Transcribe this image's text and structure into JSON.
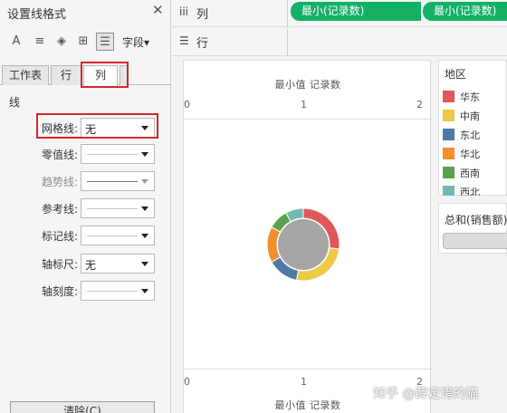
{
  "pane": {
    "title": "设置线格式",
    "close": "✕",
    "toolbar": [
      {
        "name": "font-tool-icon",
        "glyph": "A"
      },
      {
        "name": "align-tool-icon",
        "glyph": "≡"
      },
      {
        "name": "shading-tool-icon",
        "glyph": "◈"
      },
      {
        "name": "borders-tool-icon",
        "glyph": "⊞"
      },
      {
        "name": "lines-tool-icon",
        "glyph": "☰"
      }
    ],
    "field_menu": "字段▾",
    "tabs": [
      "工作表",
      "行",
      "列"
    ],
    "section": "线",
    "props": [
      {
        "label": "网格线:",
        "value": "无",
        "dim": false
      },
      {
        "label": "零值线:",
        "value": "",
        "dim": false
      },
      {
        "label": "趋势线:",
        "value": "",
        "dim": true
      },
      {
        "label": "参考线:",
        "value": "",
        "dim": false
      },
      {
        "label": "标记线:",
        "value": "",
        "dim": false
      },
      {
        "label": "轴标尺:",
        "value": "无",
        "dim": false
      },
      {
        "label": "轴刻度:",
        "value": "",
        "dim": false
      }
    ],
    "clear_button": "清除(C)"
  },
  "columns_shelf": {
    "label": "列",
    "pills": [
      "最小(记录数)",
      "最小(记录数)"
    ]
  },
  "rows_shelf": {
    "label": "行"
  },
  "view": {
    "axis_title_top": "最小值 记录数",
    "axis_title_bottom": "最小值 记录数",
    "ticks": [
      "0",
      "1",
      "2"
    ]
  },
  "legend": {
    "title": "地区",
    "items": [
      {
        "label": "华东",
        "color": "#e15759"
      },
      {
        "label": "中南",
        "color": "#edc948"
      },
      {
        "label": "东北",
        "color": "#4e79a7"
      },
      {
        "label": "华北",
        "color": "#f28e2b"
      },
      {
        "label": "西南",
        "color": "#59a14f"
      },
      {
        "label": "西北",
        "color": "#76b7b2"
      }
    ]
  },
  "size_card": {
    "title": "总和(销售额)"
  },
  "donut": {
    "slices": [
      {
        "region": "华东",
        "value": 0.27,
        "color": "#e15759"
      },
      {
        "region": "中南",
        "value": 0.26,
        "color": "#edc948"
      },
      {
        "region": "东北",
        "value": 0.14,
        "color": "#4e79a7"
      },
      {
        "region": "华北",
        "value": 0.16,
        "color": "#f28e2b"
      },
      {
        "region": "西南",
        "value": 0.09,
        "color": "#59a14f"
      },
      {
        "region": "西北",
        "value": 0.08,
        "color": "#76b7b2"
      }
    ],
    "hole_color": "#a6a6a6"
  },
  "watermark": "知乎 @薛定谔的猫"
}
